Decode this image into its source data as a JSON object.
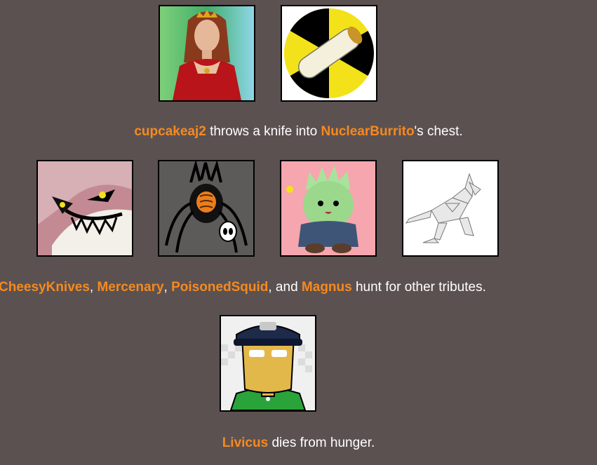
{
  "events": [
    {
      "tributes": [
        {
          "name": "cupcakeaj2",
          "avatar_icon": "queen-portrait-icon"
        },
        {
          "name": "NuclearBurrito",
          "avatar_icon": "radioactive-burrito-icon"
        }
      ],
      "text": {
        "name1": "cupcakeaj2",
        "mid1": " throws a knife into ",
        "name2": "NuclearBurrito",
        "end": "'s chest."
      }
    },
    {
      "tributes": [
        {
          "name": "CheesyKnives",
          "avatar_icon": "grinning-monster-icon"
        },
        {
          "name": "Mercenary",
          "avatar_icon": "spider-creature-icon"
        },
        {
          "name": "PoisonedSquid",
          "avatar_icon": "green-haired-character-icon"
        },
        {
          "name": "Magnus",
          "avatar_icon": "lowpoly-kangaroo-icon"
        }
      ],
      "text": {
        "name1": "CheesyKnives",
        "sep1": ", ",
        "name2": "Mercenary",
        "sep2": ", ",
        "name3": "PoisonedSquid",
        "sep3": ", and ",
        "name4": "Magnus",
        "end": " hunt for other tributes."
      }
    },
    {
      "tributes": [
        {
          "name": "Livicus",
          "avatar_icon": "police-cap-character-icon"
        }
      ],
      "text": {
        "name1": "Livicus",
        "end": " dies from hunger."
      }
    }
  ],
  "colors": {
    "background": "#5c5151",
    "tribute_name": "#f58a1f",
    "text": "#ffffff"
  }
}
